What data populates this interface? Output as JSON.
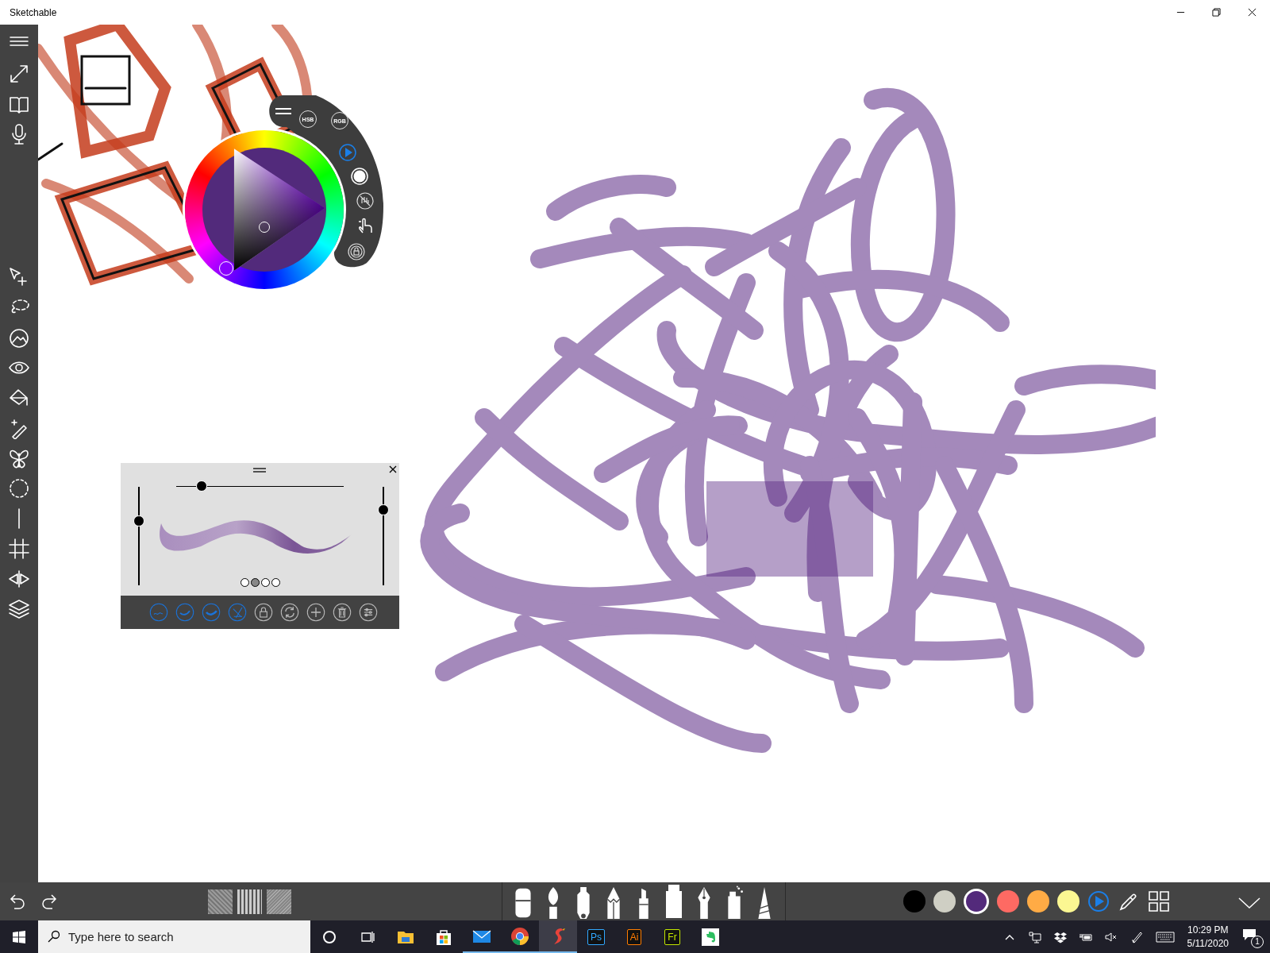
{
  "window": {
    "title": "Sketchable"
  },
  "color_picker": {
    "modes": [
      {
        "label": "HSB"
      },
      {
        "label": "RGB"
      }
    ]
  },
  "brush_panel": {
    "sliders": [
      {
        "kind": "horizontal",
        "level": 0.15
      },
      {
        "kind": "vertical",
        "level": 0.65
      },
      {
        "kind": "vertical",
        "level": 0.77
      }
    ],
    "pages": [
      {
        "selected": false
      },
      {
        "selected": true
      },
      {
        "selected": false
      },
      {
        "selected": false
      }
    ],
    "tools": [
      {
        "active": true
      },
      {
        "active": true
      },
      {
        "active": true
      },
      {
        "active": true
      },
      {
        "active": false
      },
      {
        "active": false
      },
      {
        "active": false
      },
      {
        "active": false
      },
      {
        "active": false
      }
    ]
  },
  "bottom_toolbar": {
    "brushes": [
      {
        "selected": false
      },
      {
        "selected": false
      },
      {
        "selected": false
      },
      {
        "selected": false
      },
      {
        "selected": false
      },
      {
        "selected": true
      },
      {
        "selected": false
      },
      {
        "selected": false
      },
      {
        "selected": false
      }
    ],
    "colors": [
      {
        "color": "#000000",
        "selected": false
      },
      {
        "color": "#cfcfc4",
        "selected": false
      },
      {
        "color": "#532a7b",
        "selected": true
      },
      {
        "color": "#fe6a63",
        "selected": false
      },
      {
        "color": "#ffab45",
        "selected": false
      },
      {
        "color": "#fbf792",
        "selected": false
      }
    ]
  },
  "taskbar": {
    "search": {
      "placeholder": "Type here to search"
    },
    "apps": [
      {
        "kind": "explorer",
        "running": false,
        "active": false
      },
      {
        "kind": "store",
        "running": false,
        "active": false
      },
      {
        "kind": "mail",
        "running": true,
        "active": false
      },
      {
        "kind": "chrome",
        "running": true,
        "active": false
      },
      {
        "kind": "sketchable",
        "running": true,
        "active": true
      },
      {
        "kind": "badge",
        "label": "Ps",
        "color": "#31a8ff",
        "running": false,
        "active": false
      },
      {
        "kind": "badge",
        "label": "Ai",
        "color": "#ff7c00",
        "running": false,
        "active": false
      },
      {
        "kind": "badge",
        "label": "Fr",
        "color": "#c3e600",
        "running": false,
        "active": false
      },
      {
        "kind": "evernote",
        "running": false,
        "active": false
      }
    ],
    "time": "10:29 PM",
    "date": "5/11/2020",
    "notifications": "1"
  }
}
